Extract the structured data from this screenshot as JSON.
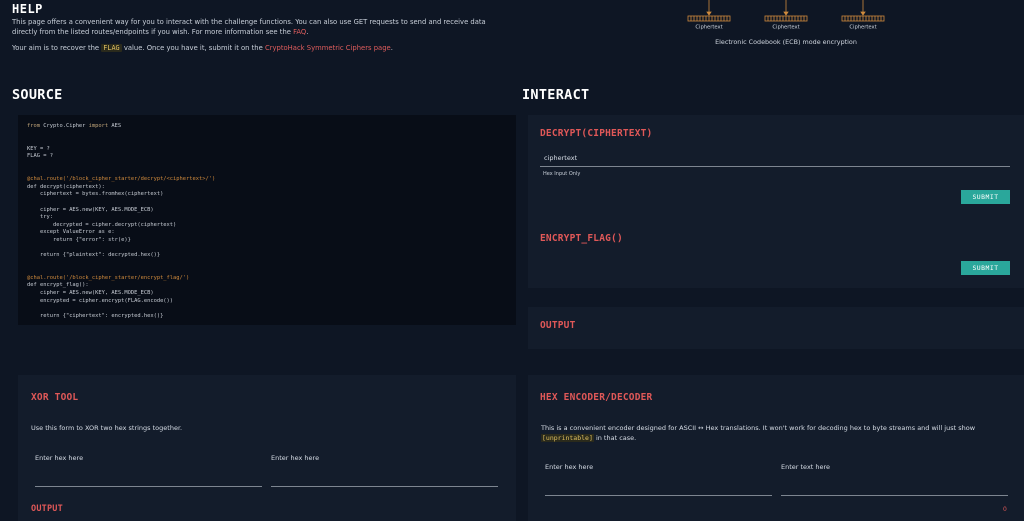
{
  "help": {
    "title": "HELP",
    "line1": "This page offers a convenient way for you to interact with the challenge functions. You can also use GET requests to send and receive data directly from the listed routes/endpoints if you wish. For more information see the ",
    "faq_link": "FAQ",
    "line1_end": ".",
    "line2_a": "Your aim is to recover the ",
    "flag_code": "FLAG",
    "line2_b": " value. Once you have it, submit it on the ",
    "page_link": "CryptoHack Symmetric Ciphers page",
    "line2_end": "."
  },
  "diagram": {
    "labels": [
      "Ciphertext",
      "Ciphertext",
      "Ciphertext"
    ],
    "caption": "Electronic Codebook (ECB) mode encryption"
  },
  "source": {
    "title": "SOURCE",
    "code": {
      "l1_a": "from ",
      "l1_b": "Crypto.Cipher ",
      "l1_c": "import ",
      "l1_d": "AES",
      "l2": "KEY = ?",
      "l3": "FLAG = ?",
      "l4_dec": "@chal.route('/block_cipher_starter/decrypt/<ciphertext>/')",
      "l5": "def decrypt(ciphertext):",
      "l6": "    ciphertext = bytes.fromhex(ciphertext)",
      "l7": "    cipher = AES.new(KEY, AES.MODE_ECB)",
      "l8": "    try:",
      "l9": "        decrypted = cipher.decrypt(ciphertext)",
      "l10": "    except ValueError as e:",
      "l11": "        return {\"error\": str(e)}",
      "l12": "    return {\"plaintext\": decrypted.hex()}",
      "l13_dec": "@chal.route('/block_cipher_starter/encrypt_flag/')",
      "l14": "def encrypt_flag():",
      "l15": "    cipher = AES.new(KEY, AES.MODE_ECB)",
      "l16": "    encrypted = cipher.encrypt(FLAG.encode())",
      "l17": "    return {\"ciphertext\": encrypted.hex()}"
    }
  },
  "interact": {
    "title": "INTERACT",
    "decrypt": {
      "title": "DECRYPT(CIPHERTEXT)",
      "field_label": "ciphertext",
      "hint": "Hex Input Only",
      "submit": "SUBMIT"
    },
    "encrypt_flag": {
      "title": "ENCRYPT_FLAG()",
      "submit": "SUBMIT"
    },
    "output": {
      "title": "OUTPUT"
    }
  },
  "xor_tool": {
    "title": "XOR TOOL",
    "description": "Use this form to XOR two hex strings together.",
    "field1_label": "Enter hex here",
    "field2_label": "Enter hex here",
    "output_title": "OUTPUT"
  },
  "hex_tool": {
    "title": "HEX ENCODER/DECODER",
    "description_a": "This is a convenient encoder designed for ASCII ↔ Hex translations. It won't work for decoding hex to byte streams and will just show ",
    "unprintable": "[unprintable]",
    "description_b": " in that case.",
    "field1_label": "Enter hex here",
    "field2_label": "Enter text here",
    "counter": "0"
  },
  "colors": {
    "background": "#0e1624",
    "panel": "#131c2b",
    "accent_red": "#e05858",
    "button_teal": "#2aa79b"
  }
}
